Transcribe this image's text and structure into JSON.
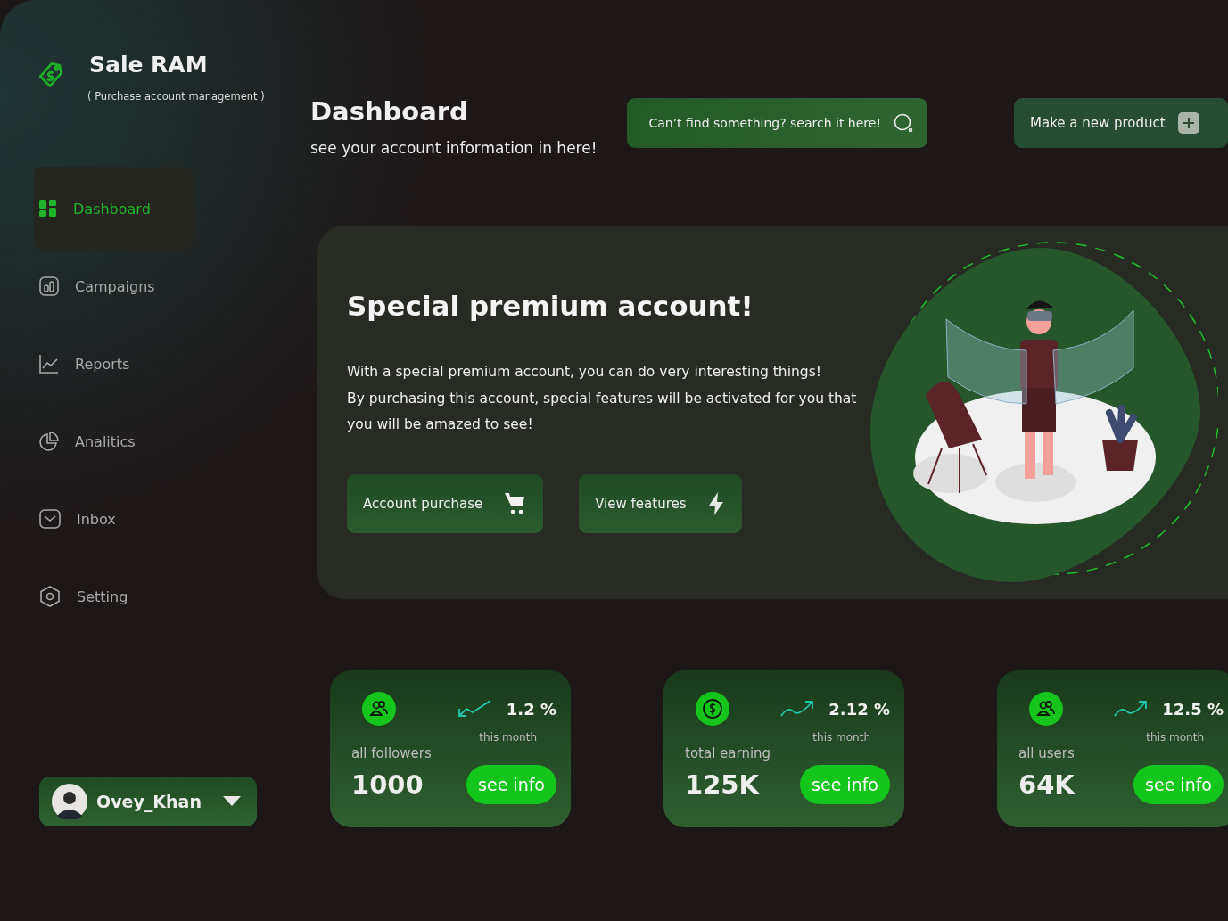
{
  "brand": {
    "name": "Sale RAM",
    "tagline": "( Purchase account management )"
  },
  "sidebar": {
    "items": [
      {
        "label": "Dashboard",
        "kind": "grid",
        "selected": true
      },
      {
        "label": "Campaigns",
        "kind": "bars",
        "selected": false
      },
      {
        "label": "Reports",
        "kind": "line",
        "selected": false
      },
      {
        "label": "Analitics",
        "kind": "pie",
        "selected": false
      },
      {
        "label": "Inbox",
        "kind": "mail",
        "selected": false
      },
      {
        "label": "Setting",
        "kind": "gear",
        "selected": false
      }
    ]
  },
  "user": {
    "name": "Ovey_Khan"
  },
  "header": {
    "title": "Dashboard",
    "subtitle": "see your account information in here!"
  },
  "search_button": {
    "label": "Can’t find something? search it here!"
  },
  "new_product_button": {
    "label": "Make a new product"
  },
  "banner": {
    "title": "Special premium account!",
    "lines": [
      "With a special premium account, you can do very interesting things!",
      "By purchasing this account, special features will be activated for you that you will be amazed to see!"
    ],
    "buttons": [
      {
        "label": "Account purchase",
        "kind": "cart"
      },
      {
        "label": "View features",
        "kind": "bolt"
      }
    ]
  },
  "stats": [
    {
      "kind": "followers",
      "change": "1.2 %",
      "period": "this month",
      "label": "all followers",
      "value": "1000",
      "action": "see info"
    },
    {
      "kind": "earning",
      "change": "2.12 %",
      "period": "this month",
      "label": "total earning",
      "value": "125K",
      "action": "see info"
    },
    {
      "kind": "users",
      "change": "12.5 %",
      "period": "this month",
      "label": "all users",
      "value": "64K",
      "action": "see info"
    }
  ]
}
